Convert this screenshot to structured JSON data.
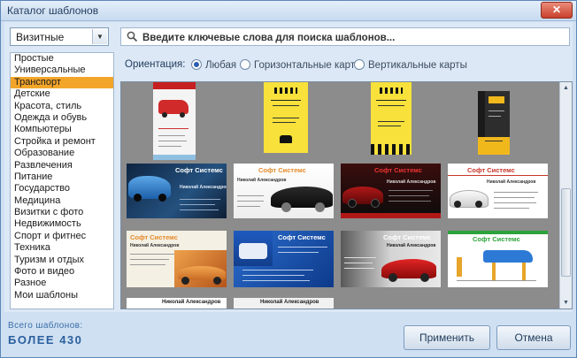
{
  "window": {
    "title": "Каталог шаблонов",
    "close_glyph": "✕"
  },
  "category_select": {
    "value": "Визитные",
    "arrow": "▼"
  },
  "categories": [
    {
      "label": "Простые",
      "selected": false
    },
    {
      "label": "Универсальные",
      "selected": false
    },
    {
      "label": "Транспорт",
      "selected": true
    },
    {
      "label": "Детские",
      "selected": false
    },
    {
      "label": "Красота, стиль",
      "selected": false
    },
    {
      "label": "Одежда и обувь",
      "selected": false
    },
    {
      "label": "Компьютеры",
      "selected": false
    },
    {
      "label": "Стройка и ремонт",
      "selected": false
    },
    {
      "label": "Образование",
      "selected": false
    },
    {
      "label": "Развлечения",
      "selected": false
    },
    {
      "label": "Питание",
      "selected": false
    },
    {
      "label": "Государство",
      "selected": false
    },
    {
      "label": "Медицина",
      "selected": false
    },
    {
      "label": "Визитки с фото",
      "selected": false
    },
    {
      "label": "Недвижимость",
      "selected": false
    },
    {
      "label": "Спорт и фитнес",
      "selected": false
    },
    {
      "label": "Техника",
      "selected": false
    },
    {
      "label": "Туризм и отдых",
      "selected": false
    },
    {
      "label": "Фото и видео",
      "selected": false
    },
    {
      "label": "Разное",
      "selected": false
    },
    {
      "label": "Мои шаблоны",
      "selected": false
    }
  ],
  "search": {
    "placeholder": "Введите ключевые слова для поиска шаблонов..."
  },
  "orientation": {
    "label": "Ориентация:",
    "options": [
      {
        "label": "Любая",
        "checked": true
      },
      {
        "label": "Горизонтальные карты",
        "checked": false
      },
      {
        "label": "Вертикальные карты",
        "checked": false
      }
    ]
  },
  "card_texts": {
    "company": "Софт Системс",
    "person": "Николай Александров"
  },
  "footer": {
    "total_label": "Всего шаблонов:",
    "total_value": "БОЛЕЕ 430"
  },
  "buttons": {
    "apply": "Применить",
    "cancel": "Отмена"
  },
  "colors": {
    "selection": "#f3a52a",
    "accent": "#2b5f9e"
  }
}
